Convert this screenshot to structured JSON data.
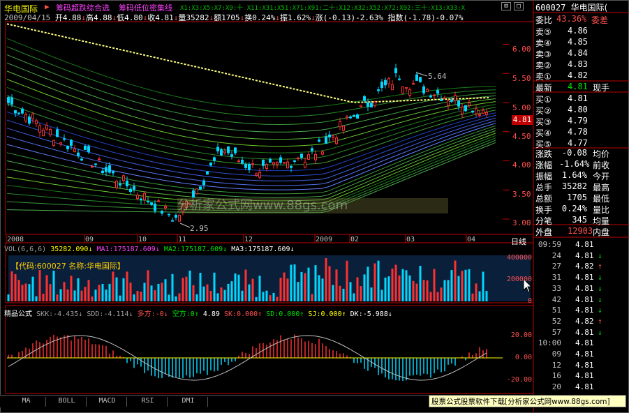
{
  "header": {
    "stock_name": "华电国际",
    "arrow": "▶",
    "formula1": "筹码超跌综合选",
    "formula2": "筹码低位密集线",
    "ma_list": "X1:X3:X5:X7:X9:十 X11:X31:X51:X71:X91:二十:X12:X32:X52:X72:X92:三十:X13:X33:X",
    "date": "2009/04/15",
    "open_label": "开",
    "open": "4.88",
    "high_label": "高",
    "high": "4.88",
    "low_label": "低",
    "low": "4.80",
    "close_label": "收",
    "close": "4.81",
    "vol_label": "量",
    "vol": "35282",
    "amt_label": "额",
    "amt": "1705",
    "turnover_label": "换",
    "turnover": "0.24%",
    "amplitude_label": "振",
    "amplitude": "1.62%",
    "change_label": "涨",
    "change": "(-0.13)-2.63%",
    "index_label": "指数",
    "index": "(-1.78)-0.07%"
  },
  "price_axis": [
    "6.00",
    "5.50",
    "5.00",
    "4.50",
    "4.00",
    "3.50",
    "3.00"
  ],
  "current_price_tag": "4.81",
  "high_mark": "5.64",
  "low_mark": "2.95",
  "date_axis": [
    "2008",
    "09",
    "10",
    "11",
    "12",
    "2009",
    "02",
    "03",
    "04"
  ],
  "date_axis_right": "日线",
  "vol_header": {
    "label": "VOL(6,6,6)",
    "vol": "35282.090",
    "ma1": "MA1:175187.609",
    "ma2": "MA2:175187.609",
    "ma3": "MA3:175187.609"
  },
  "vol_info": "【代码:600027 名称:华电国际】",
  "vol_axis": [
    "400000",
    "200000",
    "0"
  ],
  "ind_header": {
    "name": "精品公式",
    "skk": "SKK:-4.435",
    "sdd": "SDD:-4.114",
    "duo": "多方:-0",
    "kong": "空方:0",
    "val": "4.89",
    "sk": "SK:0.000",
    "sd": "SD:0.000",
    "sj": "SJ:0.000",
    "dk": "DK:-5.988"
  },
  "ind_axis": [
    "20.00",
    "0.00",
    "-20.00"
  ],
  "bottom_tabs": [
    "MA",
    "BOLL",
    "MACD",
    "RSI",
    "DMI"
  ],
  "footer_ad": "股票公式股票软件下载[分析家公式网www.88gs.com]",
  "watermark": "分析家公式网www.88gs.com",
  "right_panel": {
    "code": "600027",
    "name": "华电国际(",
    "weibi_label": "委比",
    "weibi": "43.36%",
    "weicha_label": "委差",
    "asks": [
      {
        "label": "卖⑤",
        "price": "4.86"
      },
      {
        "label": "卖④",
        "price": "4.85"
      },
      {
        "label": "卖③",
        "price": "4.84"
      },
      {
        "label": "卖②",
        "price": "4.83"
      },
      {
        "label": "卖①",
        "price": "4.82"
      }
    ],
    "latest_label": "最新",
    "latest": "4.81",
    "xianshou_label": "现手",
    "bids": [
      {
        "label": "买①",
        "price": "4.81"
      },
      {
        "label": "买②",
        "price": "4.80"
      },
      {
        "label": "买③",
        "price": "4.79"
      },
      {
        "label": "买④",
        "price": "4.78"
      },
      {
        "label": "买⑤",
        "price": "4.77"
      }
    ],
    "stats": [
      {
        "l": "涨跌",
        "v": "-0.08",
        "r": "均价"
      },
      {
        "l": "涨幅",
        "v": "-1.64%",
        "r": "前收"
      },
      {
        "l": "振幅",
        "v": "1.64%",
        "r": "今开"
      },
      {
        "l": "总手",
        "v": "35282",
        "r": "最高"
      },
      {
        "l": "总额",
        "v": "1705",
        "r": "最低"
      },
      {
        "l": "换手",
        "v": "0.24%",
        "r": "量比"
      },
      {
        "l": "分笔",
        "v": "345",
        "r": "均量"
      }
    ],
    "waipan_label": "外盘",
    "waipan": "12903",
    "neipan_label": "内盘",
    "ticks": [
      {
        "t": "09:59",
        "p": "4.81",
        "d": ""
      },
      {
        "t": "24",
        "p": "4.81",
        "d": "↓"
      },
      {
        "t": "27",
        "p": "4.82",
        "d": "↑"
      },
      {
        "t": "31",
        "p": "4.81",
        "d": "↓"
      },
      {
        "t": "33",
        "p": "4.81",
        "d": "↓"
      },
      {
        "t": "42",
        "p": "4.81",
        "d": "↓"
      },
      {
        "t": "51",
        "p": "4.81",
        "d": "↓"
      },
      {
        "t": "52",
        "p": "4.82",
        "d": "↑"
      },
      {
        "t": "57",
        "p": "4.81",
        "d": "↓"
      },
      {
        "t": "10:00",
        "p": "4.81",
        "d": ""
      },
      {
        "t": "09",
        "p": "4.81",
        "d": ""
      },
      {
        "t": "12",
        "p": "4.81",
        "d": ""
      },
      {
        "t": "16",
        "p": "4.81",
        "d": ""
      },
      {
        "t": "20",
        "p": "4.81",
        "d": ""
      }
    ]
  }
}
